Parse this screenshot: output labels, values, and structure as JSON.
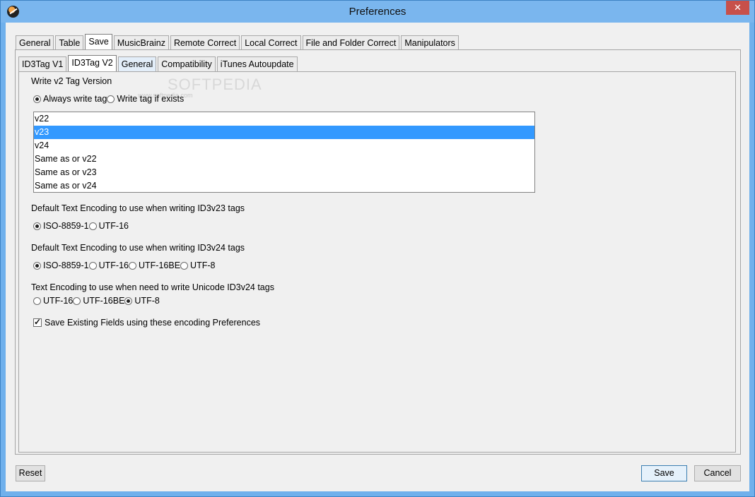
{
  "window": {
    "title": "Preferences",
    "close_glyph": "✕"
  },
  "main_tabs": [
    "General",
    "Table",
    "Save",
    "MusicBrainz",
    "Remote Correct",
    "Local Correct",
    "File and Folder Correct",
    "Manipulators"
  ],
  "sub_tabs": [
    "ID3Tag V1",
    "ID3Tag V2",
    "General",
    "Compatibility",
    "iTunes Autoupdate"
  ],
  "v2_version": {
    "label": "Write v2 Tag Version",
    "options": [
      "Always write tag",
      "Write tag if exists"
    ],
    "selected_option": "Always write tag",
    "list": [
      "v22",
      "v23",
      "v24",
      "Same as or v22",
      "Same as or v23",
      "Same as or v24"
    ],
    "selected_item": "v23"
  },
  "encoding_v23": {
    "label": "Default Text Encoding to use when writing ID3v23 tags",
    "options": [
      "ISO-8859-1",
      "UTF-16"
    ],
    "selected": "ISO-8859-1"
  },
  "encoding_v24": {
    "label": "Default Text Encoding to use when writing ID3v24 tags",
    "options": [
      "ISO-8859-1",
      "UTF-16",
      "UTF-16BE",
      "UTF-8"
    ],
    "selected": "ISO-8859-1"
  },
  "unicode_v24": {
    "label": "Text Encoding to use when need to write Unicode ID3v24 tags",
    "options": [
      "UTF-16",
      "UTF-16BE",
      "UTF-8"
    ],
    "selected": "UTF-8"
  },
  "save_existing": {
    "label": "Save Existing Fields using these encoding Preferences",
    "checked": true
  },
  "buttons": {
    "reset": "Reset",
    "save": "Save",
    "cancel": "Cancel"
  },
  "watermark": {
    "main": "SOFTPEDIA",
    "url": "www.softpedia.com"
  }
}
